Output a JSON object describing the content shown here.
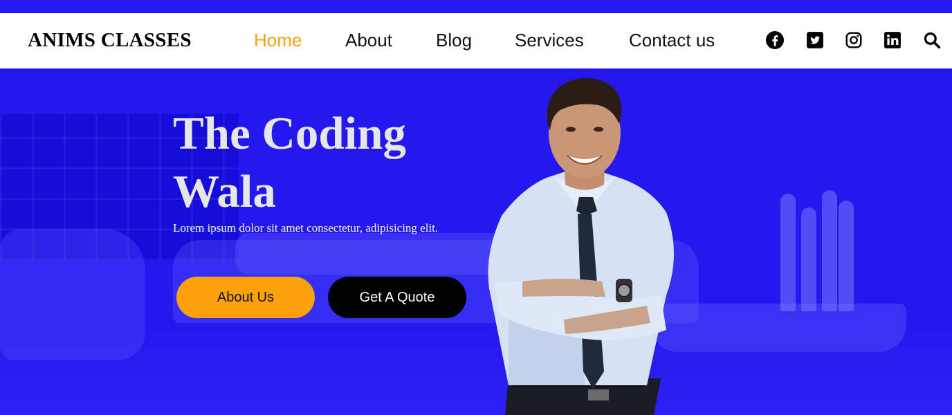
{
  "brand": "ANIMS CLASSES",
  "nav": {
    "items": [
      {
        "label": "Home",
        "active": true
      },
      {
        "label": "About",
        "active": false
      },
      {
        "label": "Blog",
        "active": false
      },
      {
        "label": "Services",
        "active": false
      },
      {
        "label": "Contact us",
        "active": false
      }
    ]
  },
  "social_icons": [
    "facebook-icon",
    "twitter-icon",
    "instagram-icon",
    "linkedin-icon",
    "search-icon"
  ],
  "hero": {
    "title_line1": "The Coding",
    "title_line2": "Wala",
    "subtitle": "Lorem ipsum dolor sit amet consectetur, adipisicing elit.",
    "buttons": {
      "about": "About Us",
      "quote": "Get A Quote"
    }
  },
  "colors": {
    "accent": "#f7a10d",
    "hero_background": "#2418ef",
    "quote_button": "#000000"
  }
}
